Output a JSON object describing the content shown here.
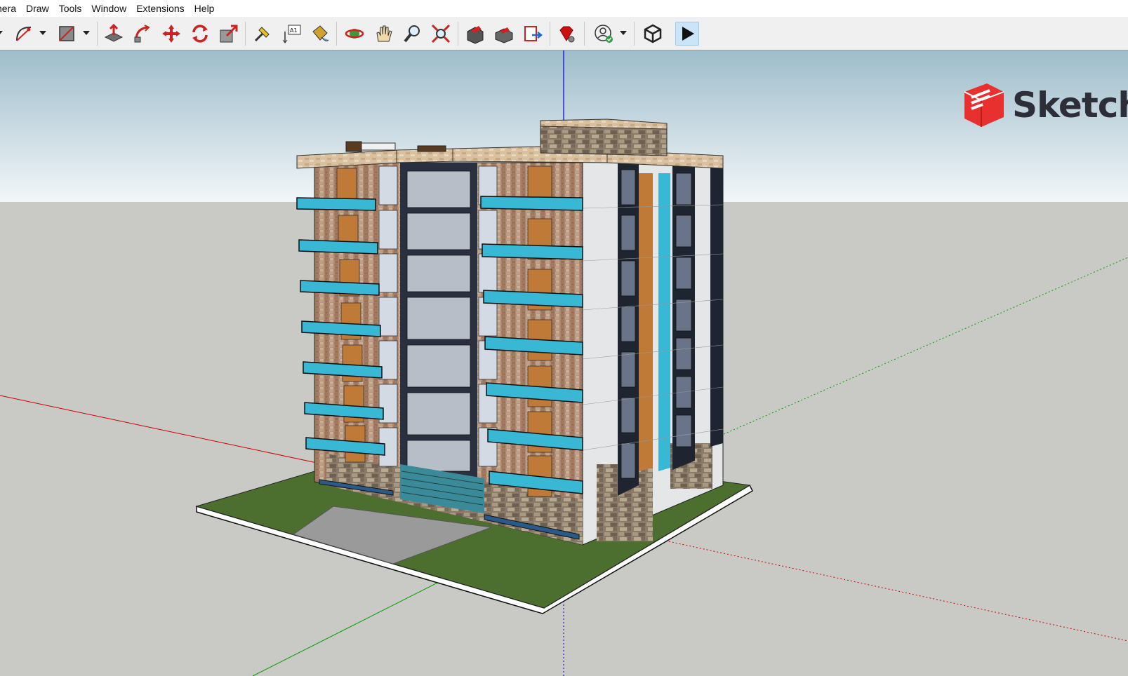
{
  "menu": {
    "items": [
      "nera",
      "Draw",
      "Tools",
      "Window",
      "Extensions",
      "Help"
    ]
  },
  "toolbar": {
    "tools": [
      {
        "name": "arc-tool-icon"
      },
      {
        "name": "rectangle-tool-icon"
      },
      {
        "name": "push-pull-tool-icon"
      },
      {
        "name": "follow-me-tool-icon"
      },
      {
        "name": "move-tool-icon"
      },
      {
        "name": "rotate-tool-icon"
      },
      {
        "name": "scale-tool-icon"
      },
      {
        "name": "tape-measure-tool-icon"
      },
      {
        "name": "text-tool-icon",
        "label": "A1"
      },
      {
        "name": "paint-bucket-tool-icon"
      },
      {
        "name": "orbit-tool-icon"
      },
      {
        "name": "pan-tool-icon"
      },
      {
        "name": "zoom-tool-icon"
      },
      {
        "name": "zoom-extents-tool-icon"
      },
      {
        "name": "3d-warehouse-icon"
      },
      {
        "name": "extension-warehouse-icon"
      },
      {
        "name": "layout-send-icon"
      },
      {
        "name": "ruby-console-icon"
      },
      {
        "name": "account-icon"
      },
      {
        "name": "unity-icon"
      },
      {
        "name": "play-icon",
        "active": true
      }
    ]
  },
  "logo": {
    "text": "Sketch",
    "color": "#e8302f"
  },
  "colors": {
    "sky_top": "#9fbdcb",
    "sky_bottom": "#f2f6f8",
    "ground": "#c9c9c6",
    "red_axis": "#cc0000",
    "green_axis": "#00a000",
    "blue_axis": "#0000cc",
    "grass": "#4c6e2e",
    "glass": "#38b8d4"
  }
}
